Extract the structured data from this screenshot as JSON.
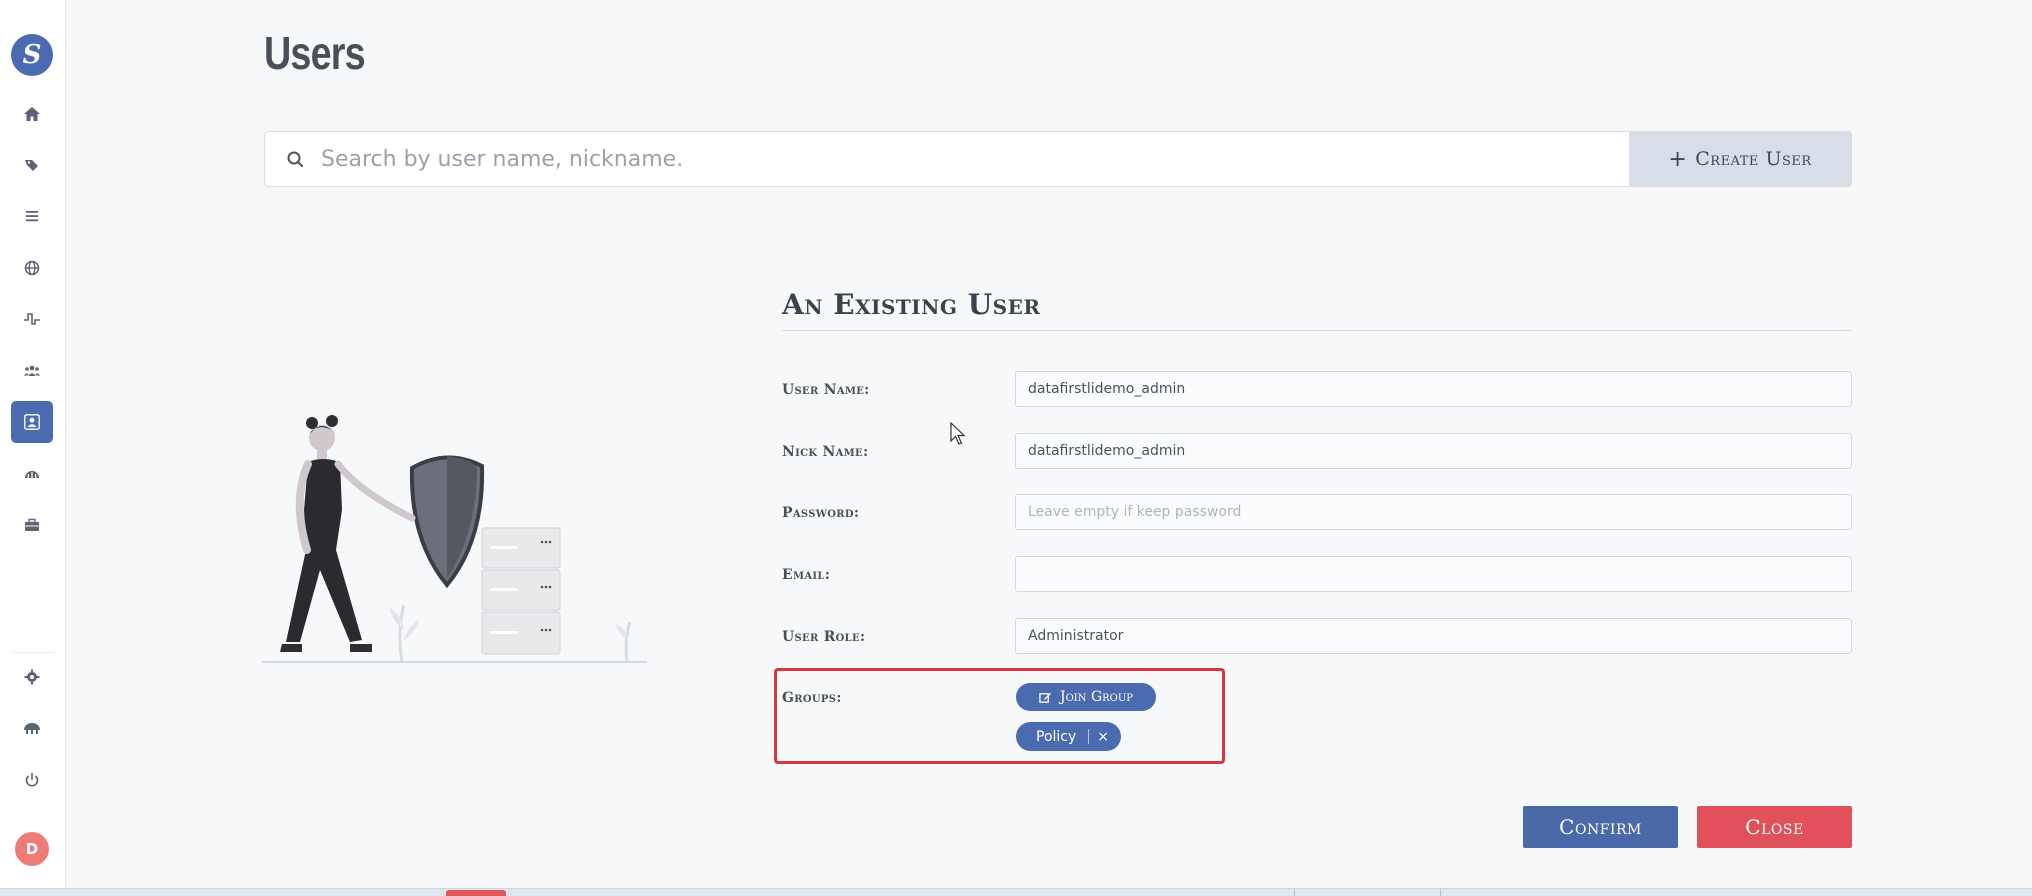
{
  "sidebar": {
    "logo_letter": "S",
    "items": [
      {
        "icon": "home-icon"
      },
      {
        "icon": "tags-icon"
      },
      {
        "icon": "list-icon"
      },
      {
        "icon": "globe-icon"
      },
      {
        "icon": "pulse-icon"
      },
      {
        "icon": "users-icon"
      },
      {
        "icon": "user-icon",
        "active": true
      },
      {
        "icon": "dashboard-icon"
      },
      {
        "icon": "toolbox-icon"
      },
      {
        "icon": "gear-icon"
      },
      {
        "icon": "umbrella-icon"
      },
      {
        "icon": "power-icon"
      }
    ],
    "user_badge": "D",
    "accent_color": "#4a6bb0"
  },
  "header": {
    "title": "Users"
  },
  "search": {
    "placeholder": "Search by user name, nickname.",
    "value": "",
    "create_button_label": "Create User",
    "create_button_icon": "+"
  },
  "form": {
    "title": "An Existing User",
    "fields": {
      "user_name": {
        "label": "User Name:",
        "value": "datafirstlidemo_admin"
      },
      "nick_name": {
        "label": "Nick Name:",
        "value": "datafirstlidemo_admin"
      },
      "password": {
        "label": "Password:",
        "value": "",
        "placeholder": "Leave empty if keep password"
      },
      "email": {
        "label": "Email:",
        "value": ""
      },
      "user_role": {
        "label": "User Role:",
        "value": "Administrator"
      }
    },
    "groups": {
      "label": "Groups:",
      "join_button_label": "Join Group",
      "tags": [
        {
          "name": "Policy",
          "remove_icon": "×"
        }
      ],
      "highlight_color": "#d9363e"
    },
    "confirm_label": "Confirm",
    "close_label": "Close",
    "confirm_color": "#4b69a9",
    "close_color": "#e0515c"
  }
}
